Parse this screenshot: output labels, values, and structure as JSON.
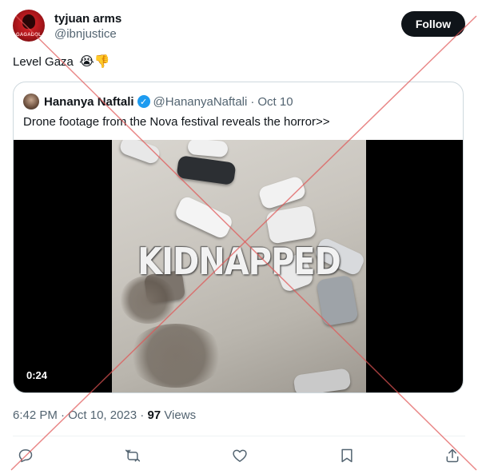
{
  "author": {
    "display_name": "tyjuan arms",
    "handle": "@ibnjustice",
    "avatar_text": "GAGADOL"
  },
  "follow_label": "Follow",
  "tweet": {
    "text": "Level Gaza",
    "emojis": "😭👎"
  },
  "quoted": {
    "display_name": "Hananya Naftali",
    "handle": "@HananyaNaftali",
    "separator": "·",
    "date": "Oct 10",
    "text": "Drone footage from the Nova festival reveals the horror>>",
    "video": {
      "overlay_text": "KIDNAPPED",
      "duration": "0:24"
    }
  },
  "meta": {
    "time": "6:42 PM",
    "separator1": "·",
    "date": "Oct 10, 2023",
    "separator2": "·",
    "views_count": "97",
    "views_label": "Views"
  },
  "actions": [
    "reply-icon",
    "retweet-icon",
    "like-icon",
    "bookmark-icon",
    "share-icon"
  ],
  "colors": {
    "accent_blue": "#1d9bf0",
    "text_primary": "#0f1419",
    "text_secondary": "#536471",
    "border": "#cfd9de",
    "cross_red": "#e05555"
  }
}
